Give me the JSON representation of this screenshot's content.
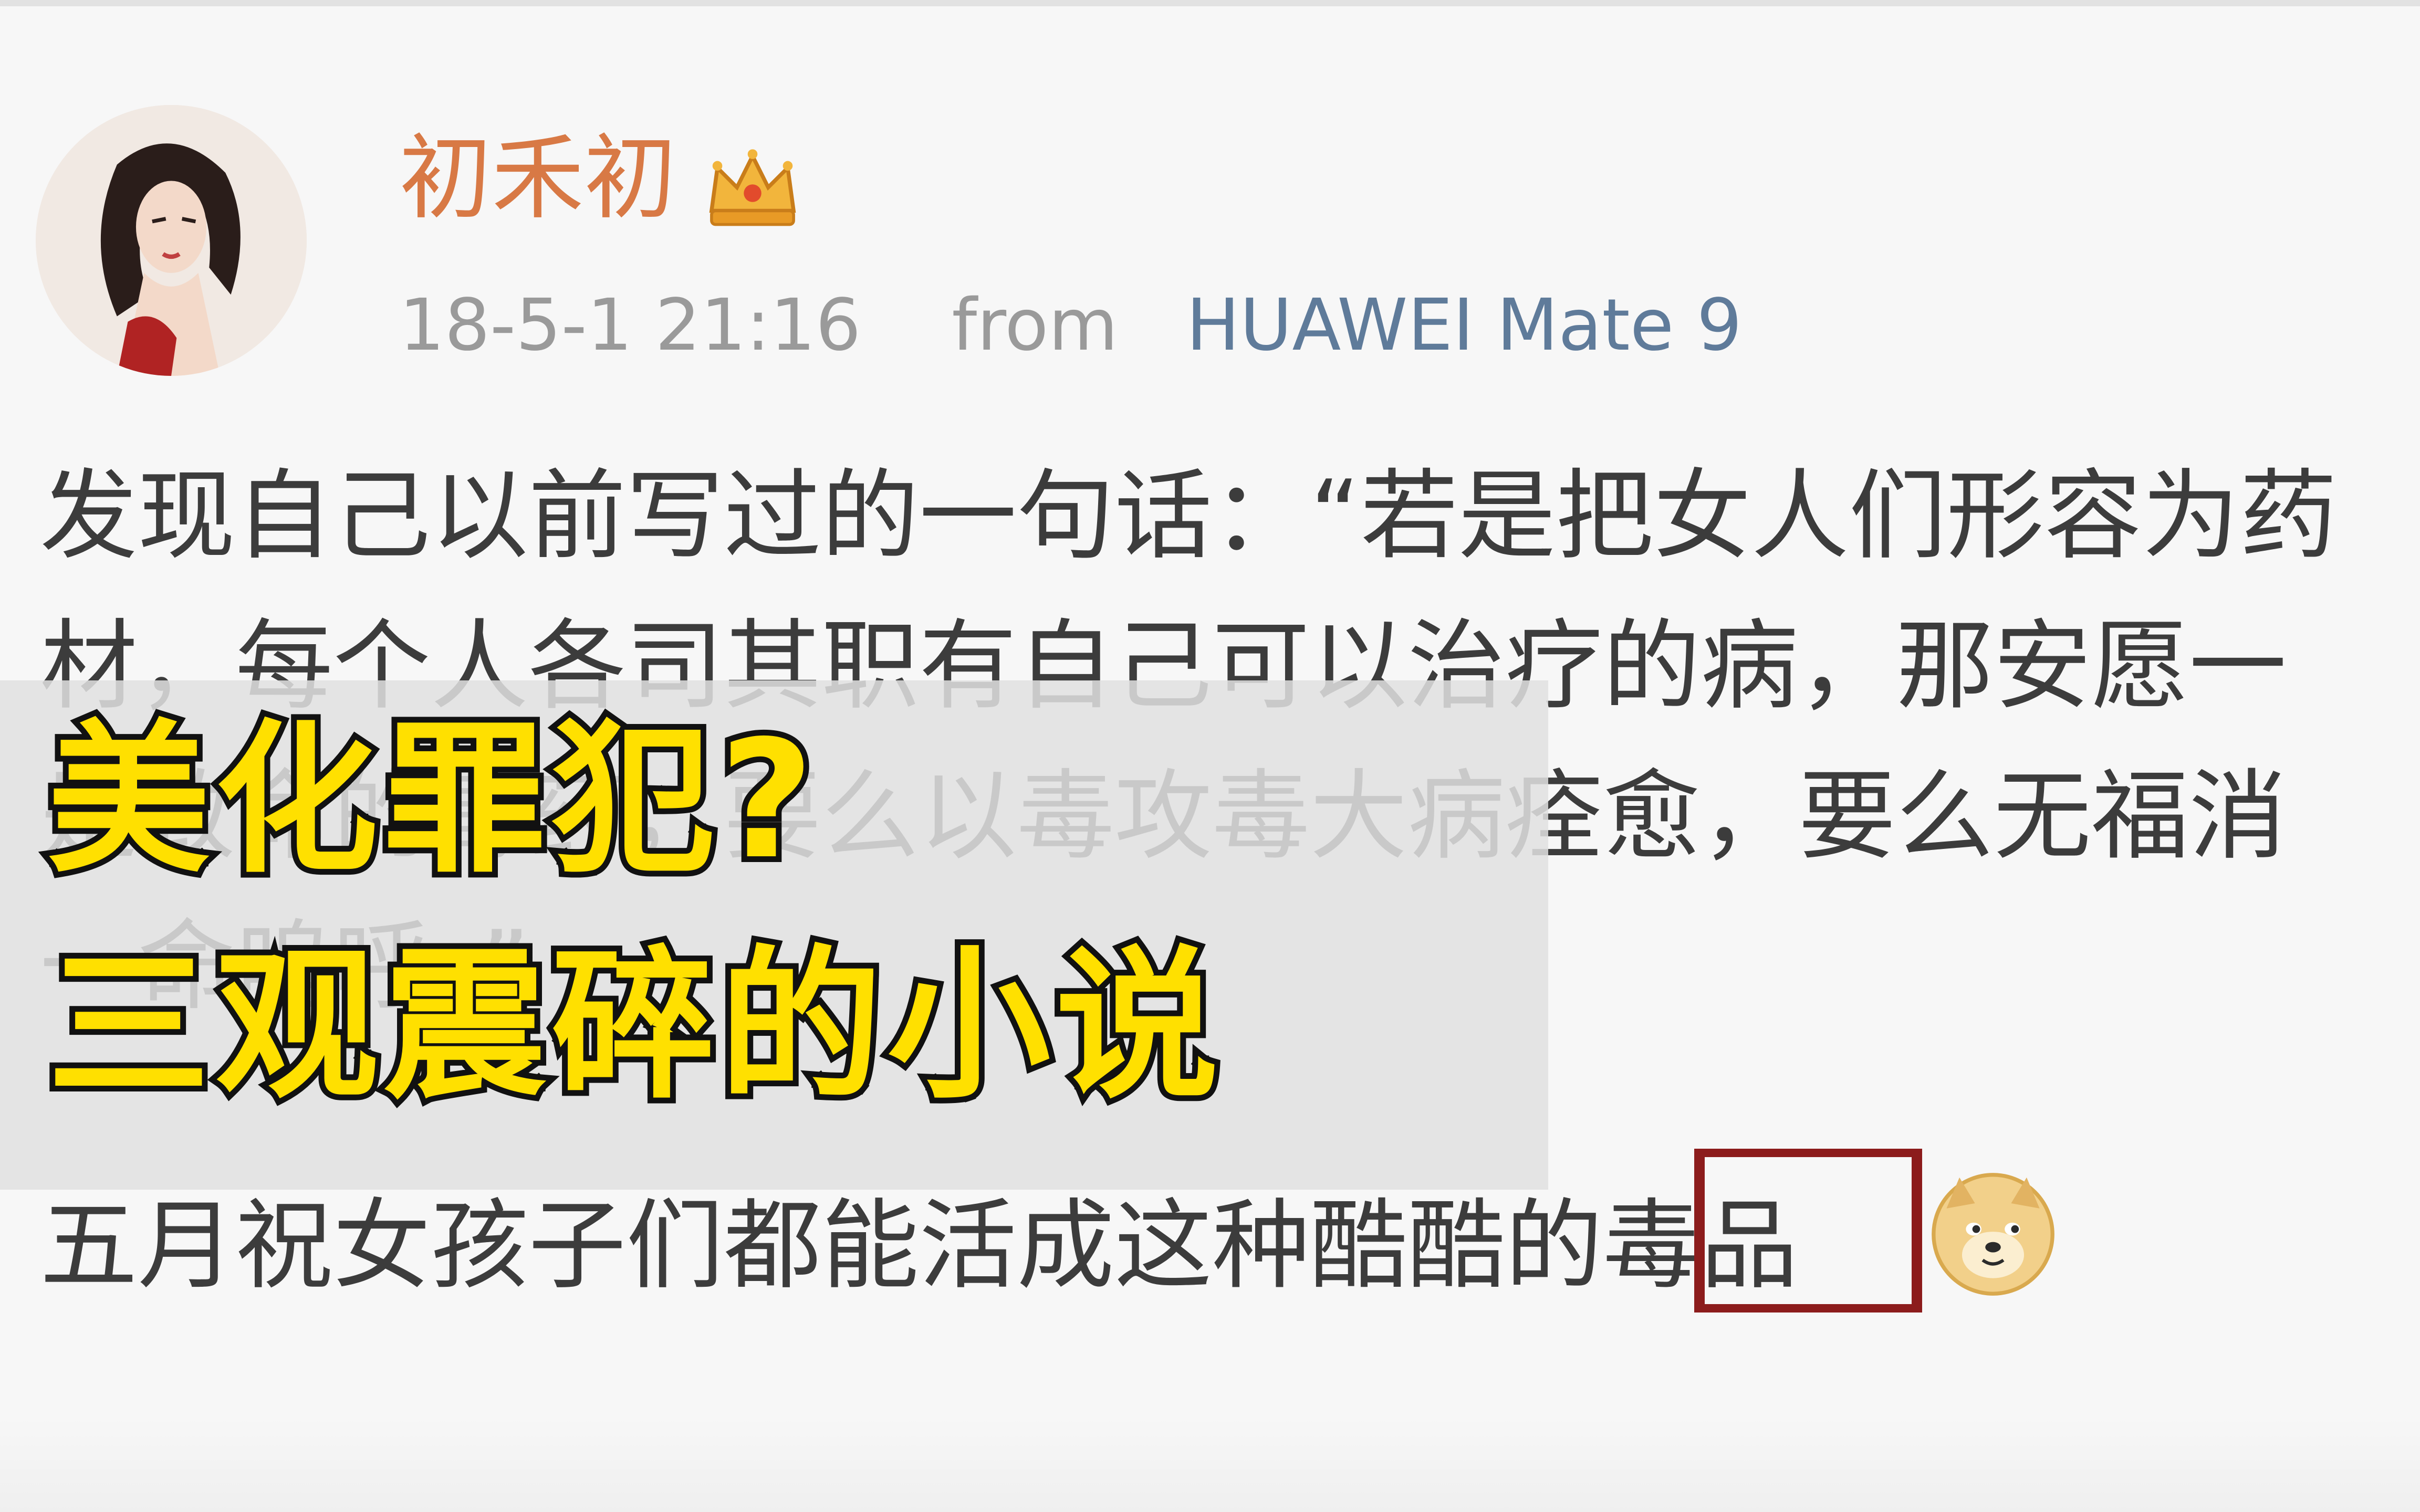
{
  "post": {
    "username": "初禾初",
    "timestamp": "18-5-1 21:16",
    "from_label": "from",
    "device": "HUAWEI Mate 9",
    "lines": [
      "发现自己以前写过的一句话：“若是把女人们形容为药",
      "材，每个人各司其职有自己可以治疗的病，那安愿一",
      "是致命的毒药，要么以毒攻毒大病痊愈，要么无福消",
      "一命呜呼。”"
    ],
    "closing": "五月祝女孩子们都能活成这种酷酷的毒品"
  },
  "overlay": {
    "line1": "美化罪犯?",
    "line2": "三观震碎的小说"
  },
  "icons": {
    "crown": "crown-icon",
    "doge": "doge-emoji-icon"
  },
  "colors": {
    "username": "#d87945",
    "device": "#5f7b9a",
    "highlight": "#8c1c1c",
    "headline": "#ffe000"
  }
}
